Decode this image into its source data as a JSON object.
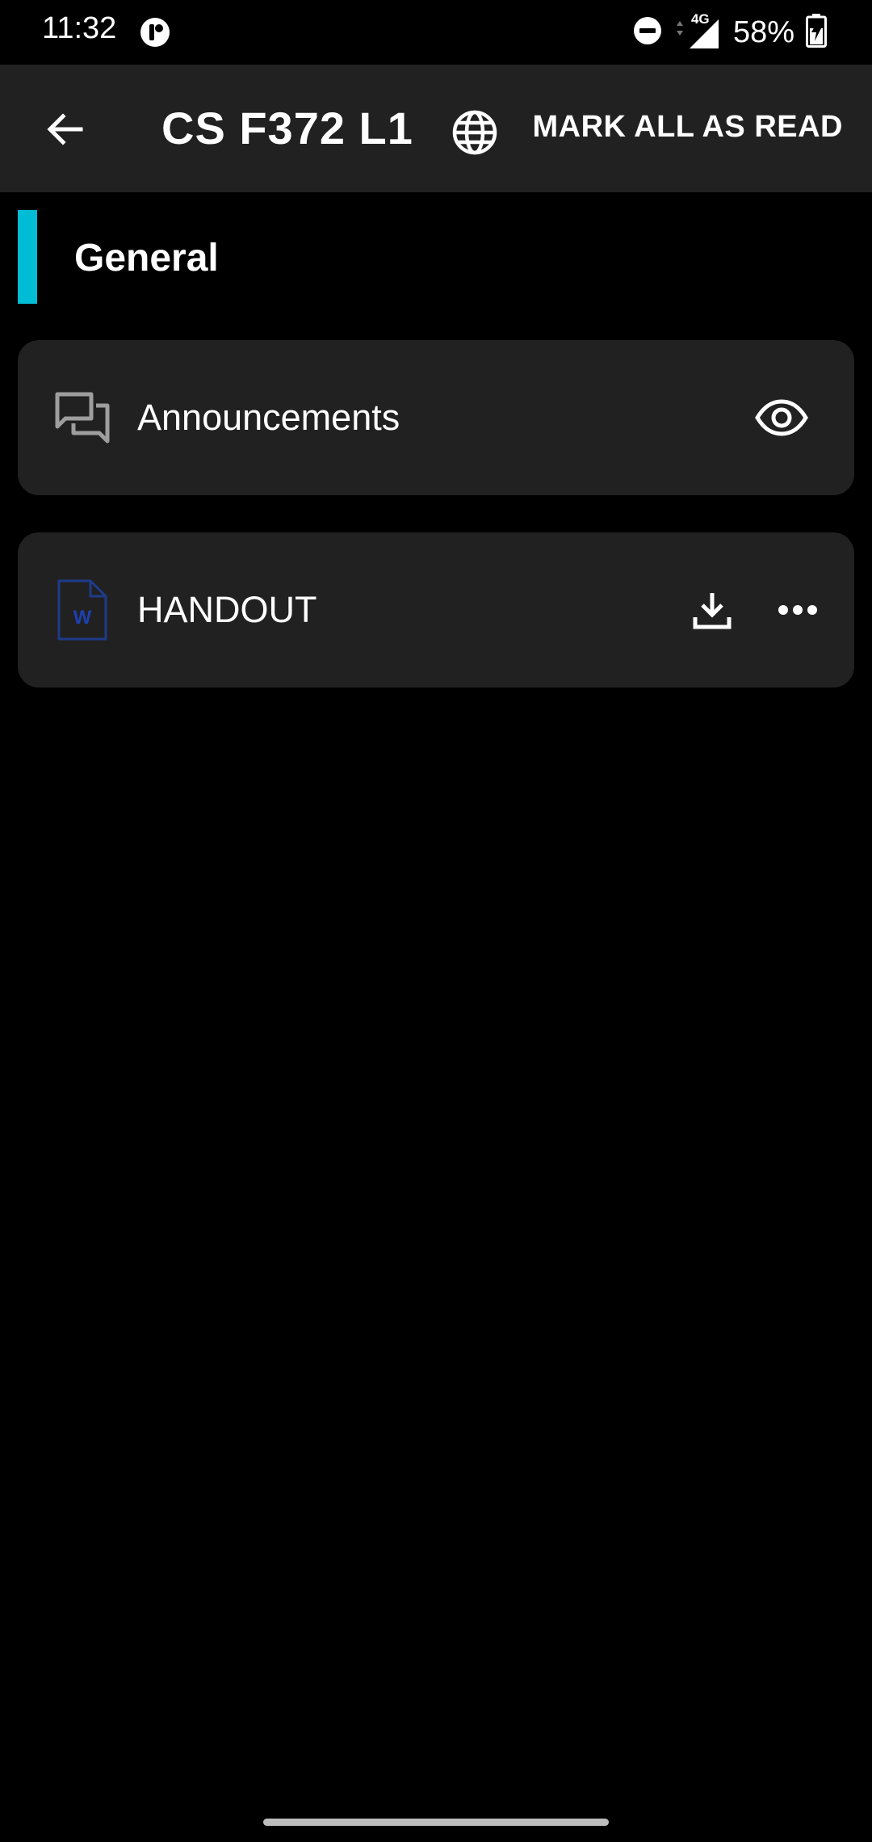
{
  "status_bar": {
    "time": "11:32",
    "network": "4G",
    "battery": "58%"
  },
  "app_bar": {
    "title": "CS F372 L1",
    "mark_all_read": "MARK ALL AS READ"
  },
  "section": {
    "title": "General",
    "accent_color": "#00bcd4"
  },
  "items": [
    {
      "label": "Announcements",
      "icon": "forum-icon",
      "action": "eye-icon"
    },
    {
      "label": "HANDOUT",
      "icon": "word-document-icon",
      "actions": [
        "download-icon",
        "more-horizontal-icon"
      ]
    }
  ]
}
